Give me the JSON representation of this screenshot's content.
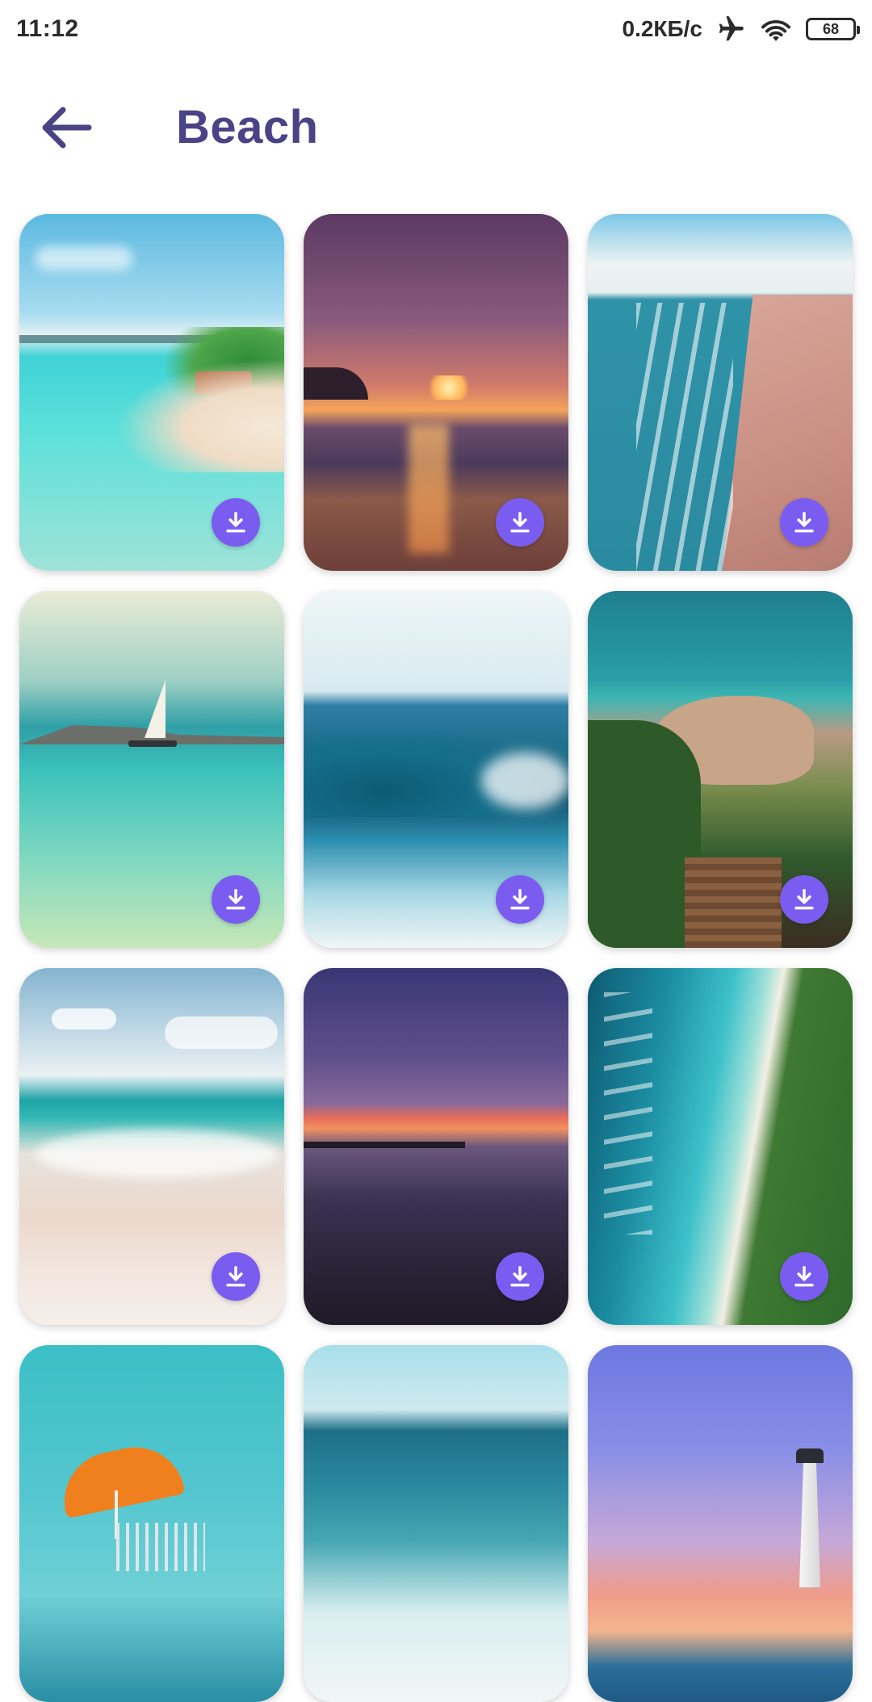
{
  "status_bar": {
    "time": "11:12",
    "net_speed": "0.2КБ/с",
    "battery": "68",
    "icons": [
      "airplane-icon",
      "wifi-icon",
      "battery-icon"
    ]
  },
  "header": {
    "back_icon": "arrow-left-icon",
    "title": "Beach"
  },
  "colors": {
    "title": "#4a4385",
    "download_button": "#7b5cf0"
  },
  "wallpapers": [
    {
      "id": "tropical-island-resort",
      "download_icon": "download-icon"
    },
    {
      "id": "purple-sunset-beach",
      "download_icon": "download-icon"
    },
    {
      "id": "aerial-shoreline",
      "download_icon": "download-icon"
    },
    {
      "id": "sailboat-lagoon",
      "download_icon": "download-icon"
    },
    {
      "id": "blue-wave",
      "download_icon": "download-icon"
    },
    {
      "id": "coastal-stairs",
      "download_icon": "download-icon"
    },
    {
      "id": "splashing-surf",
      "download_icon": "download-icon"
    },
    {
      "id": "twilight-shore",
      "download_icon": "download-icon"
    },
    {
      "id": "aerial-forest-coast",
      "download_icon": "download-icon"
    },
    {
      "id": "orange-umbrella",
      "download_icon": ""
    },
    {
      "id": "calm-horizon-surf",
      "download_icon": ""
    },
    {
      "id": "lighthouse-dusk",
      "download_icon": ""
    }
  ]
}
